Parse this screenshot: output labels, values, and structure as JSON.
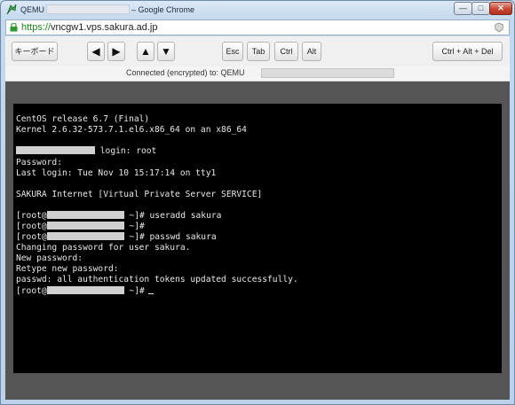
{
  "window": {
    "title_prefix": "QEMU",
    "title_suffix": "– Google Chrome",
    "min_label": "—",
    "max_label": "□",
    "close_label": "✕"
  },
  "address": {
    "scheme": "https://",
    "host": "vncgw1.vps.sakura.ad.jp"
  },
  "toolbar": {
    "keyboard_label": "キーボード",
    "left_arrow": "◀",
    "right_arrow": "▶",
    "up_arrow": "▲",
    "down_arrow": "▼",
    "esc_label": "Esc",
    "tab_label": "Tab",
    "ctrl_label": "Ctrl",
    "alt_label": "Alt",
    "cad_label": "Ctrl + Alt + Del"
  },
  "status": {
    "text": "Connected (encrypted) to: QEMU"
  },
  "terminal": {
    "l1": "CentOS release 6.7 (Final)",
    "l2": "Kernel 2.6.32-573.7.1.el6.x86_64 on an x86_64",
    "l3_suffix": " login: root",
    "l4": "Password:",
    "l5": "Last login: Tue Nov 10 15:17:14 on tty1",
    "l6": "SAKURA Internet [Virtual Private Server SERVICE]",
    "prompt_prefix": "[root@",
    "l7_suffix": " ~]# useradd sakura",
    "l8_suffix": " ~]#",
    "l9_suffix": " ~]# passwd sakura",
    "l10": "Changing password for user sakura.",
    "l11": "New password:",
    "l12": "Retype new password:",
    "l13": "passwd: all authentication tokens updated successfully.",
    "l14_suffix": " ~]#"
  },
  "colors": {
    "terminal_bg": "#000000",
    "terminal_fg": "#e8e8e8",
    "https_green": "#1b8a1b"
  }
}
